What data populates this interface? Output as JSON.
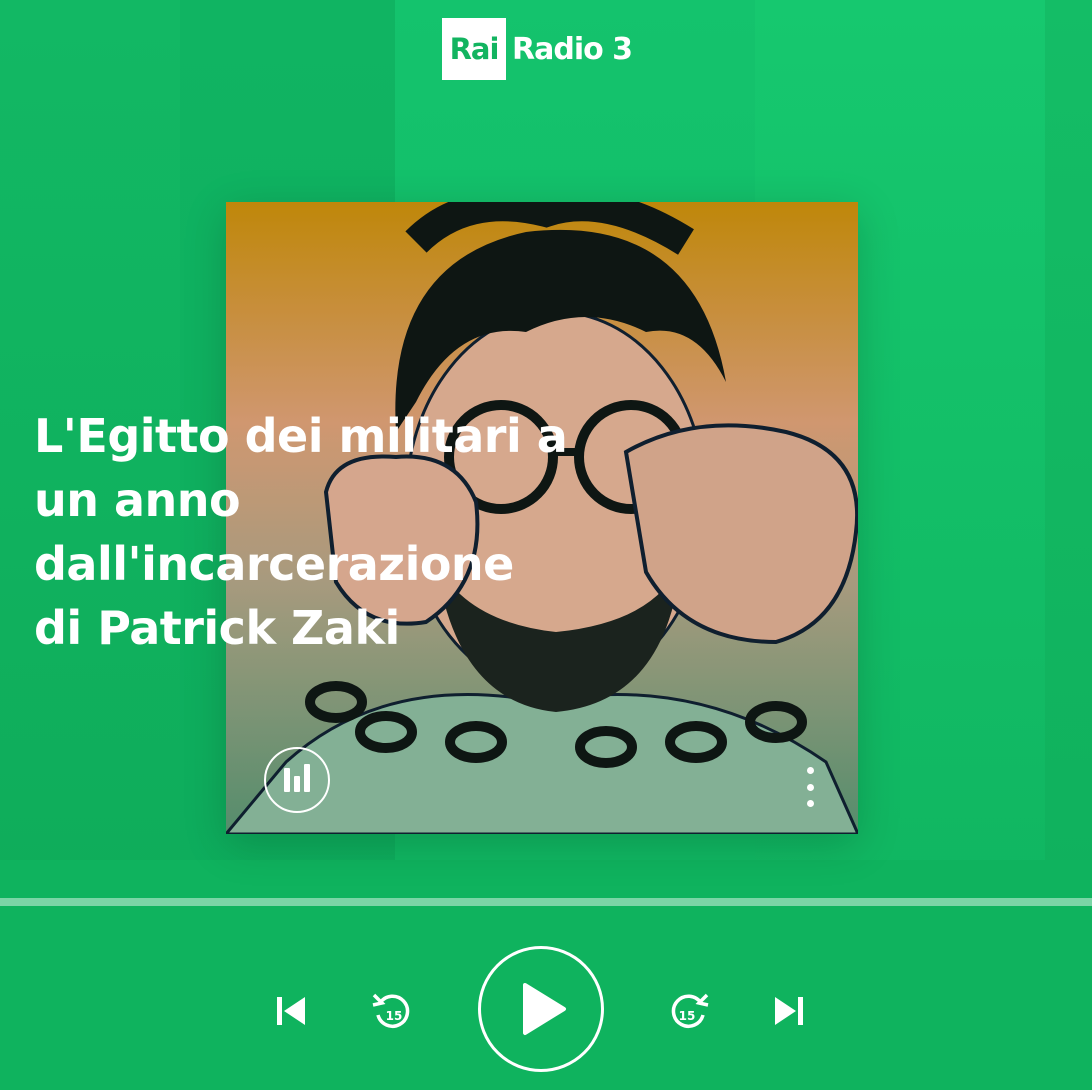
{
  "brand": {
    "logo_box_text": "Rai",
    "station_name": "Radio 3"
  },
  "episode": {
    "title_lines": [
      "L'Egitto dei militari a",
      "un anno",
      "dall'incarcerazione",
      "di Patrick Zaki"
    ],
    "cover_art": "illustration of a man with glasses raising handcuffed fists"
  },
  "cover_actions": {
    "equalizer_icon": "equalizer-icon",
    "more_icon": "more-vertical-icon"
  },
  "player": {
    "progress": 0,
    "skip_back_icon": "skip-previous-icon",
    "rewind_seconds": "15",
    "play_icon": "play-icon",
    "forward_seconds": "15",
    "skip_next_icon": "skip-next-icon"
  },
  "colors": {
    "background": "#0fb45e",
    "accent": "#ffffff",
    "cover_top": "#d1940d",
    "cover_bottom": "#5f9b77"
  }
}
